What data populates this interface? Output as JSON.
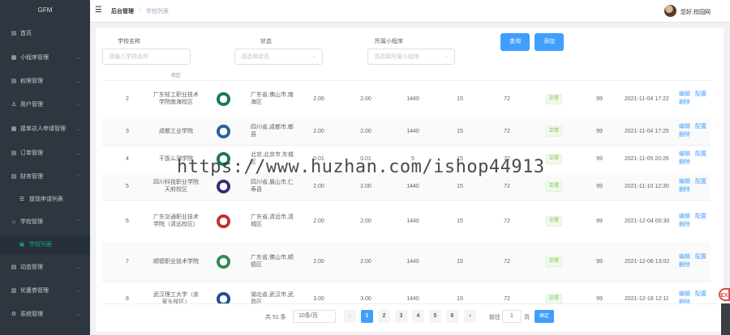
{
  "app": {
    "logo": "GFM"
  },
  "sidebar": {
    "items": [
      {
        "icon": "▤",
        "icon_name": "home-icon",
        "label": "首页",
        "arrow": ""
      },
      {
        "icon": "▦",
        "icon_name": "miniprogram-icon",
        "label": "小程序管理",
        "arrow": "⌄"
      },
      {
        "icon": "▤",
        "icon_name": "permission-icon",
        "label": "权限管理",
        "arrow": "⌄"
      },
      {
        "icon": "♙",
        "icon_name": "user-icon",
        "label": "用户管理",
        "arrow": "⌄"
      },
      {
        "icon": "▦",
        "icon_name": "courier-icon",
        "label": "接单达人申请管理",
        "arrow": "⌄"
      },
      {
        "icon": "▤",
        "icon_name": "order-icon",
        "label": "订单管理",
        "arrow": "⌄"
      },
      {
        "icon": "▤",
        "icon_name": "finance-icon",
        "label": "财务管理",
        "arrow": "⌃"
      },
      {
        "icon": "☰",
        "icon_name": "list-icon",
        "label": "提现申请列表",
        "arrow": ""
      },
      {
        "icon": "⌂",
        "icon_name": "school-icon",
        "label": "学校管理",
        "arrow": "⌃"
      },
      {
        "icon": "▣",
        "icon_name": "school-list-icon",
        "label": "学校列表",
        "arrow": ""
      },
      {
        "icon": "▤",
        "icon_name": "dynamic-icon",
        "label": "动态管理",
        "arrow": "⌄"
      },
      {
        "icon": "▥",
        "icon_name": "coupon-icon",
        "label": "优惠券管理",
        "arrow": "⌄"
      },
      {
        "icon": "⚙",
        "icon_name": "settings-icon",
        "label": "系统管理",
        "arrow": "⌄"
      }
    ]
  },
  "header": {
    "menu_icon": "☰",
    "breadcrumb_root": "后台管理",
    "breadcrumb_sep": "/",
    "breadcrumb_current": "学校列表",
    "greeting": "您好,校园网"
  },
  "filters": {
    "school_name_label": "学校名称",
    "school_name_placeholder": "请输入学校名称",
    "status_label": "状态",
    "status_placeholder": "请选择状态",
    "program_label": "所属小程序",
    "program_placeholder": "请选择所属小程序",
    "query_button": "查询",
    "add_button": "添加"
  },
  "table": {
    "partial_top_text": "校区",
    "rows": [
      {
        "id": "2",
        "name": "广东轻工职业技术学院南海校区",
        "logo_color": "#1a7a4a",
        "region": "广东省,佛山市,南海区",
        "v1": "2.00",
        "v2": "2.00",
        "v3": "1440",
        "v4": "15",
        "v5": "72",
        "status": "正常",
        "v6": "99",
        "time": "2021-11-04 17:22",
        "op1": "编辑",
        "op2": "配置",
        "op3": "删除"
      },
      {
        "id": "3",
        "name": "成都工业学院",
        "logo_color": "#2d5f9e",
        "region": "四川省,成都市,郫县",
        "v1": "2.00",
        "v2": "2.00",
        "v3": "1440",
        "v4": "15",
        "v5": "72",
        "status": "正常",
        "v6": "99",
        "time": "2021-11-04 17:25",
        "op1": "编辑",
        "op2": "配置",
        "op3": "删除"
      },
      {
        "id": "4",
        "name": "干饭么测学院",
        "logo_color": "#1a7a4a",
        "region": "北京,北京市,东城区",
        "v1": "0.01",
        "v2": "0.01",
        "v3": "5",
        "v4": "15",
        "v5": "72",
        "status": "正常",
        "v6": "99",
        "time": "2021-11-05 20:26",
        "op1": "编辑",
        "op2": "配置",
        "op3": "删除"
      },
      {
        "id": "5",
        "name": "四川科技职业学院天府校区",
        "logo_color": "#3a2a7a",
        "region": "四川省,眉山市,仁寿县",
        "v1": "2.00",
        "v2": "2.00",
        "v3": "1440",
        "v4": "15",
        "v5": "72",
        "status": "正常",
        "v6": "99",
        "time": "2021-11-10 12:30",
        "op1": "编辑",
        "op2": "配置",
        "op3": "删除"
      },
      {
        "id": "6",
        "name": "广东交通职业技术学院（清远校区）",
        "logo_color": "#c0302e",
        "region": "广东省,清远市,清城区",
        "v1": "2.00",
        "v2": "2.00",
        "v3": "1440",
        "v4": "15",
        "v5": "72",
        "status": "正常",
        "v6": "99",
        "time": "2021-12-04 00:30",
        "op1": "编辑",
        "op2": "配置",
        "op3": "删除"
      },
      {
        "id": "7",
        "name": "顺德职业技术学院",
        "logo_color": "#2e8b57",
        "region": "广东省,佛山市,顺德区",
        "v1": "2.00",
        "v2": "2.00",
        "v3": "1440",
        "v4": "15",
        "v5": "72",
        "status": "正常",
        "v6": "99",
        "time": "2021-12-06 13:02",
        "op1": "编辑",
        "op2": "配置",
        "op3": "删除"
      },
      {
        "id": "8",
        "name": "武汉理工大学（余家头校区）",
        "logo_color": "#1c4f8f",
        "region": "湖北省,武汉市,武昌区",
        "v1": "3.00",
        "v2": "3.00",
        "v3": "1440",
        "v4": "15",
        "v5": "72",
        "status": "正常",
        "v6": "99",
        "time": "2021-12-18 12:11",
        "op1": "编辑",
        "op2": "配置",
        "op3": "删除"
      }
    ]
  },
  "pagination": {
    "total": "共 51 条",
    "page_size": "10条/页",
    "prev": "‹",
    "next": "›",
    "pages": [
      "1",
      "2",
      "3",
      "4",
      "5",
      "6"
    ],
    "current": "1",
    "goto_label": "前往",
    "goto_value": "1",
    "page_suffix": "页",
    "confirm": "确定"
  },
  "overlay": {
    "watermark": "https://www.huzhan.com/ishop44913",
    "side_badge": "EX"
  },
  "colors": {
    "sidebar_bg": "#2e363f",
    "active_accent": "#1aa094",
    "primary": "#409eff",
    "tag_green": "#67c23a"
  }
}
